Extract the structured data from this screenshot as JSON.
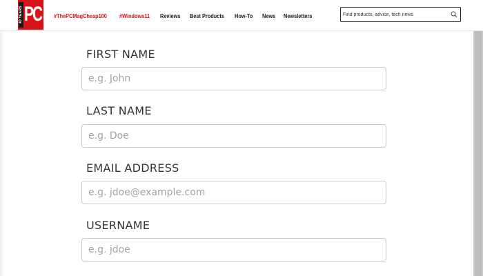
{
  "header": {
    "logo_text": "PC",
    "logo_badge": "40 YEARS",
    "nav": [
      {
        "label": "#ThePCMagCheap100",
        "style": "hot"
      },
      {
        "label": "#Windows11",
        "style": "hot"
      },
      {
        "label": "Reviews",
        "style": "normal"
      },
      {
        "label": "Best Products",
        "style": "normal"
      },
      {
        "label": "How-To",
        "style": "normal"
      },
      {
        "label": "News",
        "style": "normal"
      },
      {
        "label": "Newsletters",
        "style": "normal"
      }
    ],
    "search": {
      "placeholder": "Find products, advice, tech news",
      "icon": "search-icon"
    }
  },
  "form": {
    "fields": [
      {
        "label": "FIRST NAME",
        "placeholder": "e.g. John",
        "value": ""
      },
      {
        "label": "LAST NAME",
        "placeholder": "e.g. Doe",
        "value": ""
      },
      {
        "label": "EMAIL ADDRESS",
        "placeholder": "e.g. jdoe@example.com",
        "value": ""
      },
      {
        "label": "USERNAME",
        "placeholder": "e.g. jdoe",
        "value": ""
      }
    ]
  },
  "colors": {
    "brand_red": "#d7141a",
    "label_text": "#333333",
    "placeholder_text": "#a3a3a3",
    "input_border": "#c9c9c9"
  }
}
